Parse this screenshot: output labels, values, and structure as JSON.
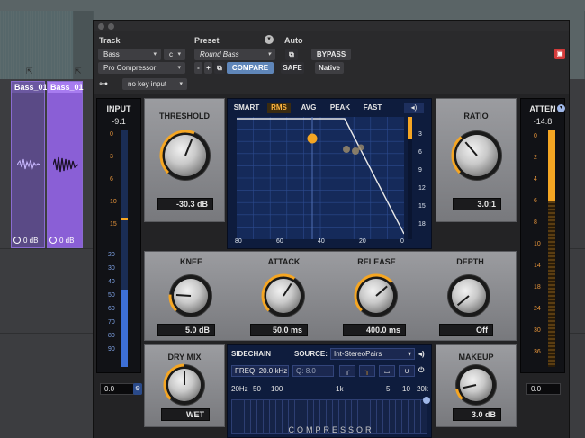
{
  "daw": {
    "clip1": {
      "name": "Bass_01",
      "gain": "0 dB"
    },
    "clip2": {
      "name": "Bass_01",
      "gain": "0 dB"
    }
  },
  "header": {
    "track_label": "Track",
    "preset_label": "Preset",
    "auto_label": "Auto",
    "track_name": "Bass",
    "track_channel": "c",
    "preset_name": "Round Bass",
    "plugin_name": "Pro Compressor",
    "compare_label": "COMPARE",
    "bypass_label": "BYPASS",
    "safe_label": "SAFE",
    "native_label": "Native",
    "minus_label": "-",
    "plus_label": "+",
    "key_input": "no key input"
  },
  "input_meter": {
    "title": "INPUT",
    "value": "-9.1",
    "readout": "0.0",
    "scale_orange": [
      "0",
      "3",
      "6",
      "10",
      "15"
    ],
    "scale_blue": [
      "20",
      "30",
      "40",
      "50",
      "60",
      "70",
      "80",
      "90"
    ]
  },
  "atten_meter": {
    "title": "ATTEN",
    "value": "-14.8",
    "readout": "0.0",
    "scale": [
      "0",
      "2",
      "4",
      "6",
      "8",
      "10",
      "14",
      "18",
      "24",
      "30",
      "36"
    ]
  },
  "threshold": {
    "label": "THRESHOLD",
    "value": "-30.3 dB",
    "level": 0.58
  },
  "ratio": {
    "label": "RATIO",
    "value": "3.0:1",
    "level": 0.35
  },
  "knee": {
    "label": "KNEE",
    "value": "5.0 dB",
    "level": 0.18
  },
  "attack": {
    "label": "ATTACK",
    "value": "50.0 ms",
    "level": 0.62
  },
  "release": {
    "label": "RELEASE",
    "value": "400.0 ms",
    "level": 0.68
  },
  "depth": {
    "label": "DEPTH",
    "value": "Off",
    "level": 0.02
  },
  "drymix": {
    "label": "DRY MIX",
    "value": "WET",
    "level": 0.5
  },
  "makeup": {
    "label": "MAKEUP",
    "value": "3.0 dB",
    "level": 0.12
  },
  "graph": {
    "modes": [
      "SMART",
      "RMS",
      "AVG",
      "PEAK",
      "FAST"
    ],
    "active_mode": "RMS",
    "x_ticks": [
      "80",
      "60",
      "40",
      "20",
      "0"
    ],
    "y_ticks": [
      "3",
      "6",
      "9",
      "12",
      "15",
      "18"
    ]
  },
  "sidechain": {
    "title": "SIDECHAIN",
    "source_label": "SOURCE:",
    "source_value": "Int-StereoPairs",
    "freq_label": "FREQ:",
    "freq_value": "20.0 kHz",
    "q_label": "Q:",
    "q_value": "8.0",
    "scale": [
      "20Hz",
      "50",
      "100",
      "1k",
      "5",
      "10",
      "20k"
    ]
  },
  "footer": {
    "title": "COMPRESSOR"
  },
  "colors": {
    "accent_orange": "#f5a623",
    "panel_blue": "#0e1c3d",
    "meter_blue": "#3d6fd6"
  }
}
